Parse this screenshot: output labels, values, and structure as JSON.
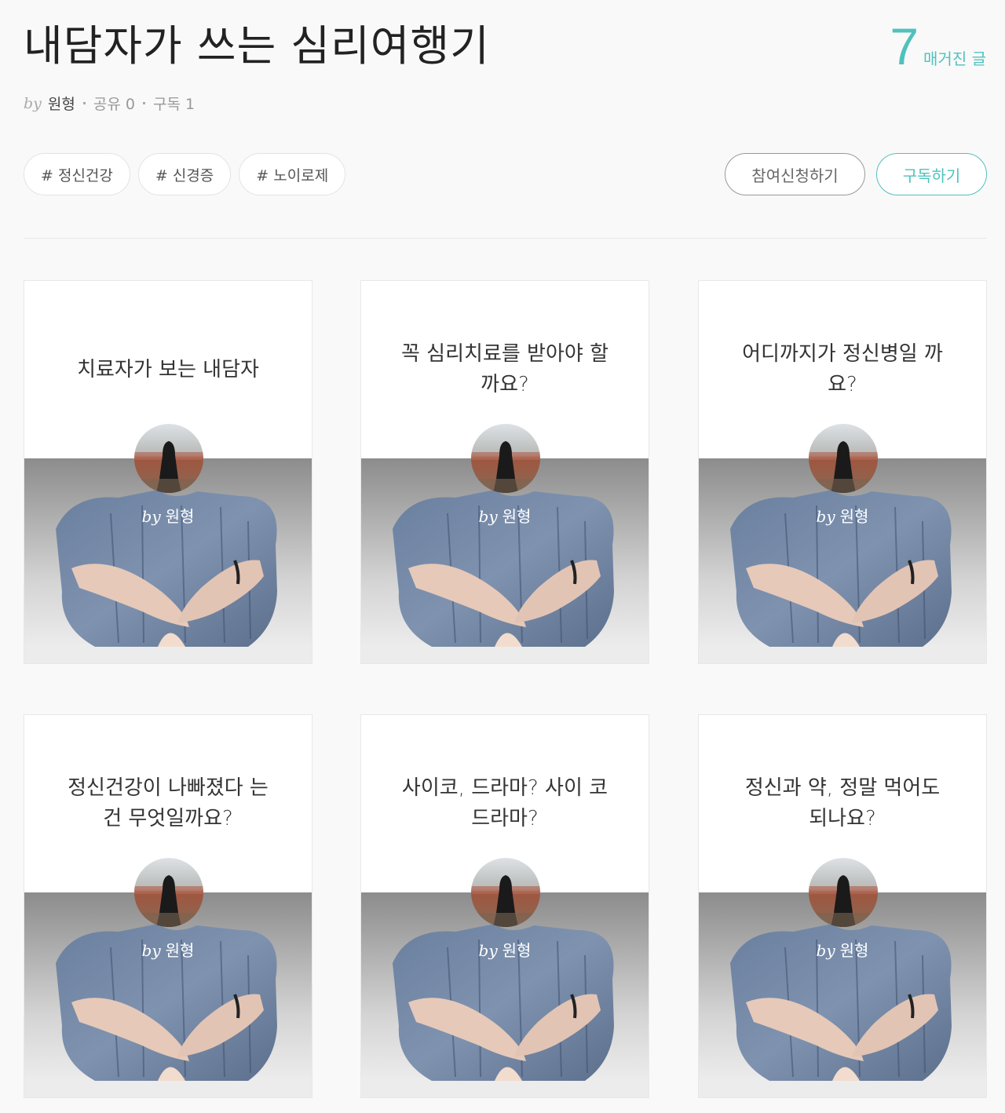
{
  "header": {
    "title": "내담자가 쓰는 심리여행기",
    "article_count": "7",
    "article_count_label": "매거진 글",
    "by_prefix": "by",
    "author": "원형",
    "share_label": "공유 0",
    "subscribe_count_label": "구독 1"
  },
  "tags": [
    "# 정신건강",
    "# 신경증",
    "# 노이로제"
  ],
  "actions": {
    "join_label": "참여신청하기",
    "subscribe_label": "구독하기"
  },
  "colors": {
    "accent": "#4fc2bd",
    "background": "#f9f9f9"
  },
  "cards": [
    {
      "title": "치료자가 보는 내담자",
      "by": "by",
      "author": "원형"
    },
    {
      "title": "꼭 심리치료를 받아야 할까요?",
      "by": "by",
      "author": "원형"
    },
    {
      "title": "어디까지가 정신병일 까요?",
      "by": "by",
      "author": "원형"
    },
    {
      "title": "정신건강이 나빠졌다 는 건 무엇일까요?",
      "by": "by",
      "author": "원형"
    },
    {
      "title": "사이코, 드라마? 사이 코드라마?",
      "by": "by",
      "author": "원형"
    },
    {
      "title": "정신과 약, 정말 먹어도 되나요?",
      "by": "by",
      "author": "원형"
    }
  ]
}
